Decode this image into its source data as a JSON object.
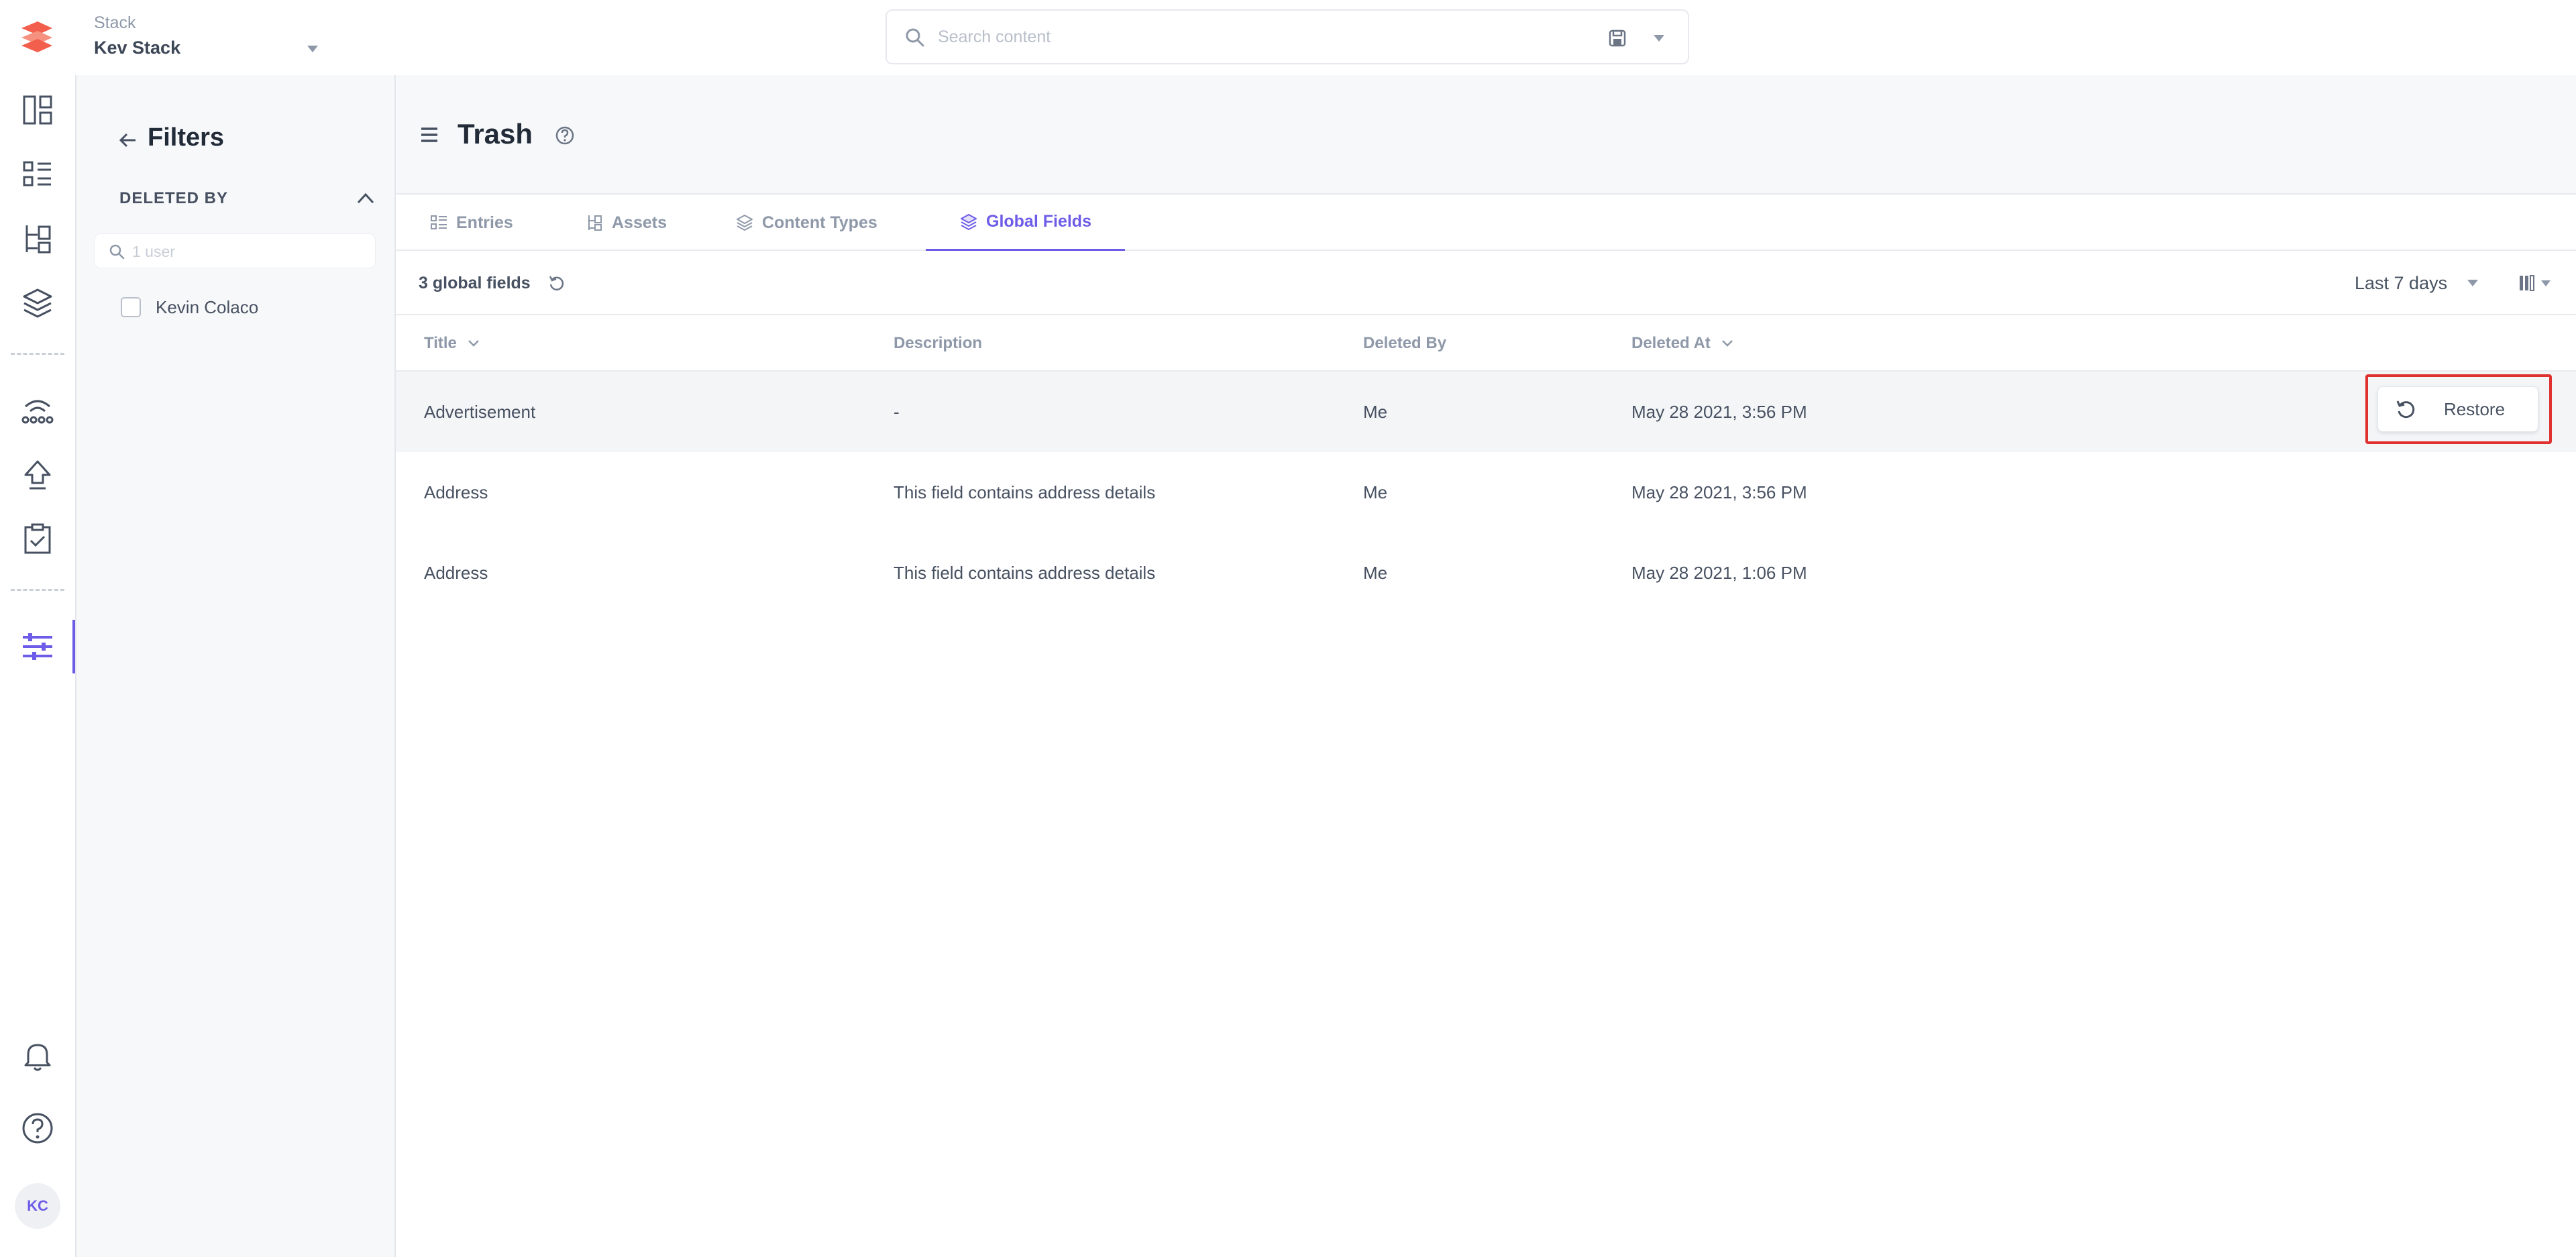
{
  "stack": {
    "label": "Stack",
    "name": "Kev Stack"
  },
  "search": {
    "placeholder": "Search content"
  },
  "rail": {
    "items": [
      "dashboard",
      "entries",
      "content-models",
      "assets",
      "releases",
      "deployments",
      "tasks",
      "settings"
    ],
    "avatar_initials": "KC"
  },
  "filters": {
    "title": "Filters",
    "section_label": "DELETED BY",
    "search_placeholder": "1 user",
    "options": [
      {
        "label": "Kevin Colaco",
        "checked": false
      }
    ]
  },
  "page": {
    "title": "Trash"
  },
  "tabs": [
    {
      "label": "Entries",
      "icon": "entries-icon",
      "active": false
    },
    {
      "label": "Assets",
      "icon": "assets-icon",
      "active": false
    },
    {
      "label": "Content Types",
      "icon": "content-types-icon",
      "active": false
    },
    {
      "label": "Global Fields",
      "icon": "global-fields-icon",
      "active": true
    }
  ],
  "toolbar": {
    "count_label": "3 global fields",
    "date_filter": "Last 7 days"
  },
  "table": {
    "columns": [
      "Title",
      "Description",
      "Deleted By",
      "Deleted At"
    ],
    "rows": [
      {
        "title": "Advertisement",
        "description": "-",
        "deleted_by": "Me",
        "deleted_at": "May 28 2021, 3:56 PM"
      },
      {
        "title": "Address",
        "description": "This field contains address details",
        "deleted_by": "Me",
        "deleted_at": "May 28 2021, 3:56 PM"
      },
      {
        "title": "Address",
        "description": "This field contains address details",
        "deleted_by": "Me",
        "deleted_at": "May 28 2021, 1:06 PM"
      }
    ],
    "restore_label": "Restore"
  },
  "colors": {
    "accent": "#6c5ce7",
    "highlight": "#e03131",
    "logo": "#f25f4c"
  }
}
